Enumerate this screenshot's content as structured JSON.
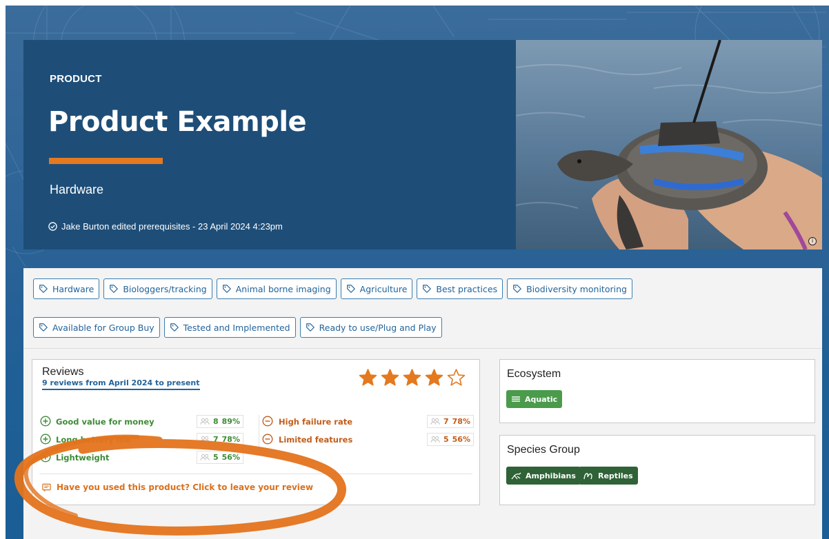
{
  "hero": {
    "label": "PRODUCT",
    "title": "Product Example",
    "subtitle": "Hardware",
    "edit_note": "Jake Burton edited prerequisites -  23 April 2024 4:23pm",
    "accent": "#e4791f",
    "photo_info": "i"
  },
  "tags": [
    "Hardware",
    "Biologgers/tracking",
    "Animal borne imaging",
    "Agriculture",
    "Best practices",
    "Biodiversity monitoring",
    "Available for Group Buy",
    "Tested and Implemented",
    "Ready to use/Plug and Play"
  ],
  "reviews": {
    "title": "Reviews",
    "subtitle": "9 reviews from April 2024 to present",
    "rating": 4,
    "rating_max": 5,
    "pros": [
      {
        "label": "Good value for money",
        "count": "8",
        "percent": "89%"
      },
      {
        "label": "Long battery life",
        "count": "7",
        "percent": "78%"
      },
      {
        "label": "Lightweight",
        "count": "5",
        "percent": "56%"
      }
    ],
    "cons": [
      {
        "label": "High failure rate",
        "count": "7",
        "percent": "78%"
      },
      {
        "label": "Limited features",
        "count": "5",
        "percent": "56%"
      }
    ],
    "cta": "Have you used this product? Click to leave your review"
  },
  "ecosystem": {
    "title": "Ecosystem",
    "items": [
      "Aquatic"
    ]
  },
  "species": {
    "title": "Species Group",
    "items": [
      "Amphibians",
      "Reptiles"
    ]
  },
  "colors": {
    "brand_blue": "#22639a",
    "positive": "#3e8b36",
    "negative": "#c25d1b",
    "star": "#e4791f"
  }
}
